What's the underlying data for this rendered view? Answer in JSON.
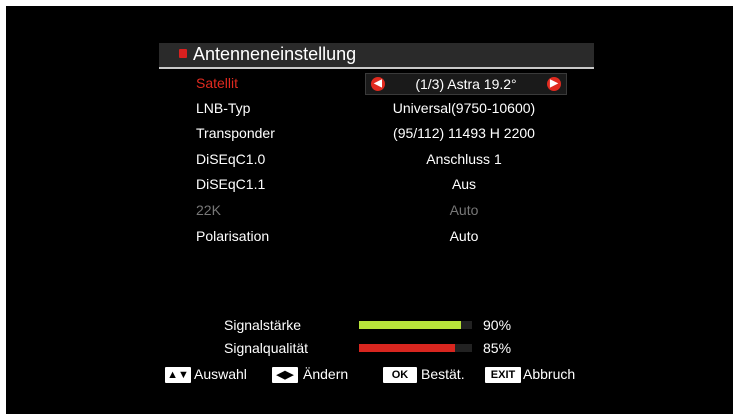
{
  "window": {
    "title": "Antenneneinstellung"
  },
  "rows": [
    {
      "label": "Satellit",
      "value": "(1/3) Astra 19.2°"
    },
    {
      "label": "LNB-Typ",
      "value": "Universal(9750-10600)"
    },
    {
      "label": "Transponder",
      "value": "(95/112) 11493 H 2200"
    },
    {
      "label": "DiSEqC1.0",
      "value": "Anschluss 1"
    },
    {
      "label": "DiSEqC1.1",
      "value": "Aus"
    },
    {
      "label": "22K",
      "value": "Auto"
    },
    {
      "label": "Polarisation",
      "value": "Auto"
    }
  ],
  "signal": {
    "strength": {
      "label": "Signalstärke",
      "percent": 90,
      "value": "90%",
      "color": "#b8e33a"
    },
    "quality": {
      "label": "Signalqualität",
      "percent": 85,
      "value": "85%",
      "color": "#d8261f"
    }
  },
  "footer": {
    "keys": [
      {
        "key": "▲▼",
        "text": "Auswahl"
      },
      {
        "key": "◀▶",
        "text": "Ändern"
      },
      {
        "key": "OK",
        "text": "Bestät."
      },
      {
        "key": "EXIT",
        "text": "Abbruch"
      }
    ]
  },
  "colors": {
    "accent": "#e02a1f",
    "background": "#000000",
    "disabled": "#777777"
  }
}
